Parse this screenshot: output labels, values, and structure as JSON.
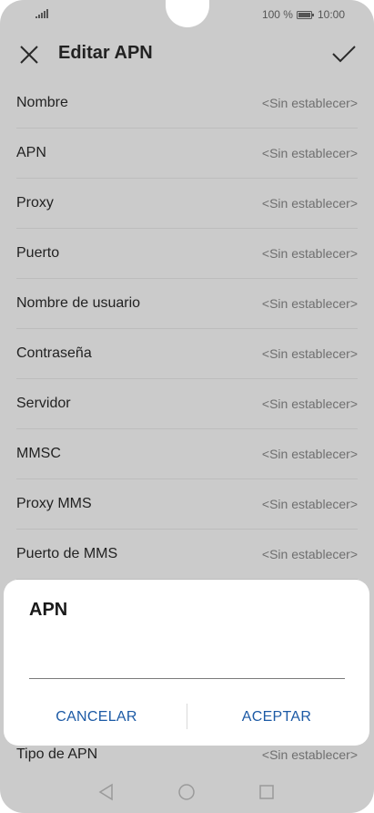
{
  "status_bar": {
    "battery": "100 %",
    "time": "10:00"
  },
  "header": {
    "title": "Editar APN"
  },
  "rows": [
    {
      "label": "Nombre",
      "value": "<Sin establecer>"
    },
    {
      "label": "APN",
      "value": "<Sin establecer>"
    },
    {
      "label": "Proxy",
      "value": "<Sin establecer>"
    },
    {
      "label": "Puerto",
      "value": "<Sin establecer>"
    },
    {
      "label": "Nombre de usuario",
      "value": "<Sin establecer>"
    },
    {
      "label": "Contraseña",
      "value": "<Sin establecer>"
    },
    {
      "label": "Servidor",
      "value": "<Sin establecer>"
    },
    {
      "label": "MMSC",
      "value": "<Sin establecer>"
    },
    {
      "label": "Proxy MMS",
      "value": "<Sin establecer>"
    },
    {
      "label": "Puerto de MMS",
      "value": "<Sin establecer>"
    }
  ],
  "last_row": {
    "label": "Tipo de APN",
    "value": "<Sin establecer>"
  },
  "dialog": {
    "title": "APN",
    "input_value": "",
    "cancel_label": "CANCELAR",
    "accept_label": "ACEPTAR"
  },
  "colors": {
    "accent": "#1c5aa5",
    "dimmed_background": "#cbcbcb"
  },
  "icons": [
    "close-icon",
    "check-icon",
    "signal-icon",
    "battery-icon",
    "back-icon",
    "home-icon",
    "recent-apps-icon"
  ]
}
